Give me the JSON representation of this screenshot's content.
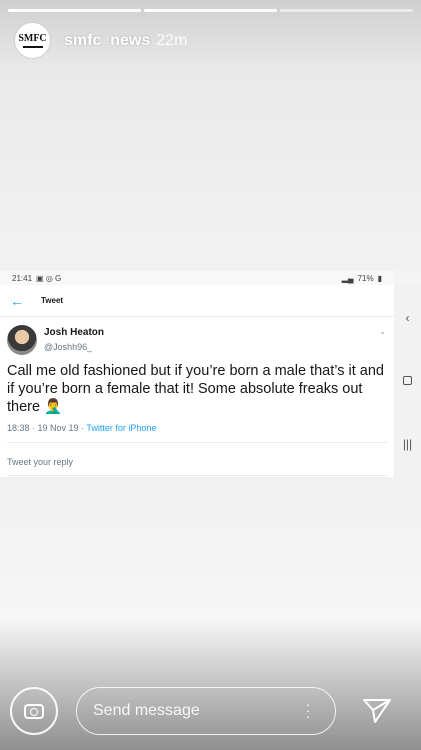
{
  "story": {
    "username": "smfc_news",
    "time_ago": "22m",
    "logo_text": "SMFC"
  },
  "screenshot": {
    "statusbar": {
      "time": "21:41",
      "battery": "71%"
    },
    "nav": {
      "title": "Tweet"
    },
    "tweet": {
      "name": "Josh Heaton",
      "handle": "@Joshh96_",
      "text": "Call me old fashioned but if you’re born a male that’s it and if you’re born a female that it! Some absolute freaks out there 🤦‍♂️",
      "timestamp": "18:38 · 19 Nov 19 · ",
      "client": "Twitter for iPhone"
    },
    "reply_placeholder": "Tweet your reply"
  },
  "bottom": {
    "message_placeholder": "Send message"
  },
  "icons": [
    "camera-icon",
    "send-icon",
    "more-options-icon",
    "back-arrow-icon",
    "chevron-down-icon"
  ]
}
